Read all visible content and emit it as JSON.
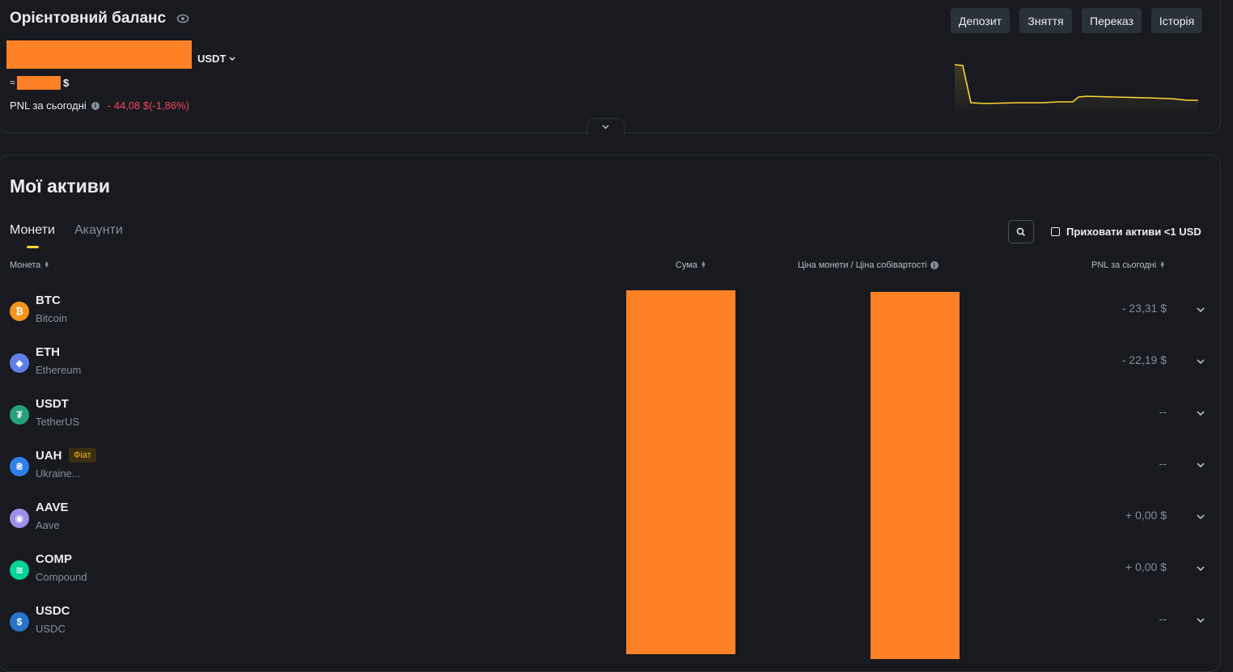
{
  "balance": {
    "title": "Орієнтовний баланс",
    "currency": "USDT",
    "approx_prefix": "≈",
    "approx_suffix": "$",
    "pnl_label": "PNL за сьогодні",
    "pnl_value": "- 44,08 $(-1,86%)",
    "pnl_color": "#f6465d"
  },
  "actions": {
    "deposit": "Депозит",
    "withdraw": "Зняття",
    "transfer": "Переказ",
    "history": "Історія"
  },
  "assets": {
    "title": "Мої активи",
    "tabs": [
      "Монети",
      "Акаунти"
    ],
    "hide_small_label": "Приховати активи <1 USD",
    "columns": {
      "coin": "Монета",
      "amount": "Сума",
      "price": "Ціна монети / Ціна собівартості",
      "pnl": "PNL за сьогодні"
    },
    "rows": [
      {
        "symbol": "BTC",
        "name": "Bitcoin",
        "pnl": "- 23,31 $",
        "icon": "bitcoin-icon",
        "color": "#f7931a",
        "glyph": "₿"
      },
      {
        "symbol": "ETH",
        "name": "Ethereum",
        "pnl": "- 22,19 $",
        "icon": "ethereum-icon",
        "color": "#627eea",
        "glyph": "◆"
      },
      {
        "symbol": "USDT",
        "name": "TetherUS",
        "pnl": "--",
        "icon": "tether-icon",
        "color": "#26a17b",
        "glyph": "₮"
      },
      {
        "symbol": "UAH",
        "name": "Ukraine...",
        "pnl": "--",
        "icon": "hryvnia-icon",
        "color": "#2f80ed",
        "glyph": "₴",
        "badge": "Фіат"
      },
      {
        "symbol": "AAVE",
        "name": "Aave",
        "pnl": "+ 0,00 $",
        "icon": "aave-icon",
        "color": "#9b8fe6",
        "glyph": "◉"
      },
      {
        "symbol": "COMP",
        "name": "Compound",
        "pnl": "+ 0,00 $",
        "icon": "compound-icon",
        "color": "#00d395",
        "glyph": "≋"
      },
      {
        "symbol": "USDC",
        "name": "USDC",
        "pnl": "--",
        "icon": "usdc-icon",
        "color": "#2775ca",
        "glyph": "$"
      }
    ]
  },
  "colors": {
    "background": "#181a20",
    "accent": "#fcd535",
    "redaction": "#ff8126"
  }
}
